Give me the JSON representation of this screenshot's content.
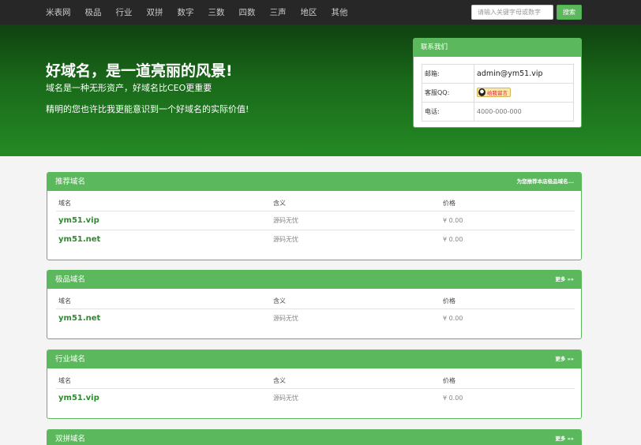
{
  "nav": {
    "items": [
      "米表网",
      "极品",
      "行业",
      "双拼",
      "数字",
      "三数",
      "四数",
      "三声",
      "地区",
      "其他"
    ]
  },
  "search": {
    "placeholder": "请输入关键字母或数字",
    "button_label": "搜索"
  },
  "hero": {
    "title": "好域名，是一道亮丽的风景!",
    "subtitle": "域名是一种无形资产，好域名比CEO更重要",
    "subtitle2": "精明的您也许比我更能意识到一个好域名的实际价值!"
  },
  "contact": {
    "title": "联系我们",
    "rows": [
      {
        "label": "邮箱:",
        "value": "admin@ym51.vip"
      },
      {
        "label": "客服QQ:",
        "value": "给我留言"
      },
      {
        "label": "电话:",
        "value": "4000-000-000"
      }
    ]
  },
  "panels": [
    {
      "title": "推荐域名",
      "more": "为您推荐本店极品域名...",
      "headers": [
        "域名",
        "含义",
        "价格"
      ],
      "rows": [
        {
          "domain": "ym51.vip",
          "meaning": "源码无忧",
          "price": "¥ 0.00"
        },
        {
          "domain": "ym51.net",
          "meaning": "源码无忧",
          "price": "¥ 0.00"
        }
      ]
    },
    {
      "title": "极品域名",
      "more": "更多 »»",
      "headers": [
        "域名",
        "含义",
        "价格"
      ],
      "rows": [
        {
          "domain": "ym51.net",
          "meaning": "源码无忧",
          "price": "¥ 0.00"
        }
      ]
    },
    {
      "title": "行业域名",
      "more": "更多 »»",
      "headers": [
        "域名",
        "含义",
        "价格"
      ],
      "rows": [
        {
          "domain": "ym51.vip",
          "meaning": "源码无忧",
          "price": "¥ 0.00"
        }
      ]
    },
    {
      "title": "双拼域名",
      "more": "更多 »»",
      "headers": [],
      "rows": []
    }
  ],
  "colors": {
    "accent": "#5cb85c",
    "navbar": "#272727",
    "domain_link": "#2d8a2d"
  }
}
